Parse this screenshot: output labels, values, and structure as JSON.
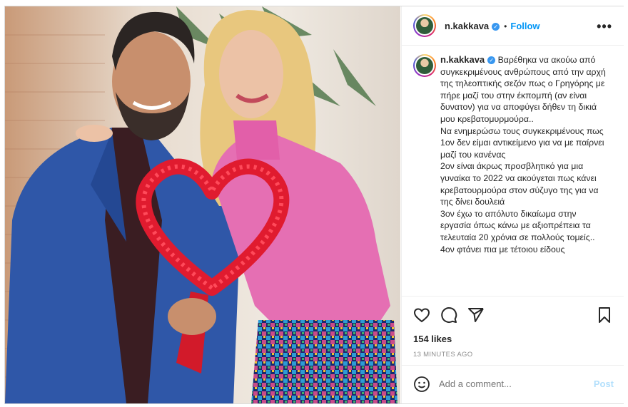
{
  "post": {
    "username": "n.kakkava",
    "verified_icon": "verified-badge-icon",
    "follow_label": "Follow",
    "separator": "•",
    "more_label": "•••",
    "caption": "Βαρέθηκα να ακούω από συγκεκριμένους ανθρώπους από την αρχή της τηλεοπτικής σεζόν πως ο Γρηγόρης με πήρε μαζί του στην έκπομπή (αν είναι δυνατον) για να αποφύγει δήθεν τη δικιά μου κρεβατομυρμούρα..\nΝα ενημερώσω τους συγκεκριμένους πως\n1ον δεν είμαι αντικείμενο για να με παίρνει μαζί του κανένας\n2ον είναι άκρως προσβλητικό για μια γυναίκα το 2022 να ακούγεται πως κάνει κρεβατουρμούρα στον σύζυγο της για να της δίνει δουλειά\n3ον έχω το απόλυτο δικαίωμα στην εργασία όπως κάνω με αξιοπρέπεια τα τελευταία 20 χρόνια σε πολλούς τομείς..\n4ον φτάνει πια με τέτοιου είδους",
    "likes": "154 likes",
    "time_ago": "13 MINUTES AGO",
    "comment_placeholder": "Add a comment...",
    "post_label": "Post"
  },
  "icons": {
    "like": "heart-icon",
    "comment": "comment-icon",
    "share": "share-icon",
    "save": "bookmark-icon",
    "emoji": "emoji-icon",
    "more": "more-options-icon"
  },
  "colors": {
    "link_blue": "#0095f6",
    "post_disabled": "#b2dffc",
    "meta_gray": "#8e8e8e",
    "text": "#262626"
  }
}
